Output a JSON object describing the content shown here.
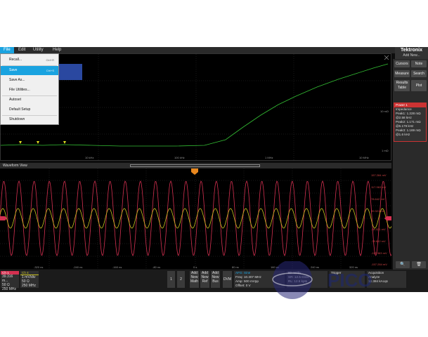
{
  "menubar": {
    "file": "File",
    "edit": "Edit",
    "utility": "Utility",
    "help": "Help"
  },
  "brand": {
    "name": "Tektronix",
    "sub": "Add New..."
  },
  "file_menu": {
    "items": [
      {
        "label": "Recall...",
        "shortcut": "Ctrl+R"
      },
      {
        "label": "Save",
        "shortcut": "Ctrl+S"
      },
      {
        "label": "Save As...",
        "shortcut": ""
      },
      {
        "label": "File Utilities...",
        "shortcut": ""
      },
      {
        "label": "Autoset",
        "shortcut": ""
      },
      {
        "label": "Default Setup",
        "shortcut": ""
      },
      {
        "label": "Shutdown",
        "shortcut": ""
      }
    ]
  },
  "spectrum": {
    "x_labels": [
      "10 kHz",
      "100 kHz",
      "1 MHz",
      "10 MHz"
    ],
    "y_labels": [
      "10 mΩ",
      "1 mΩ"
    ]
  },
  "waveform": {
    "title": "Waveform View",
    "time_labels": [
      "-320 ns",
      "-240 ns",
      "-160 ns",
      "-80 ns",
      "0 s",
      "80 ns",
      "160 ns",
      "240 ns",
      "320 ns"
    ],
    "volt_labels": [
      "157.284 mV",
      "117.963 mV",
      "78.642 mV",
      "39.321 mV",
      "-39.321 mV",
      "-78.642 mV",
      "-117.963 mV",
      "-157.284 mV"
    ]
  },
  "side": {
    "cursors": "Cursors",
    "note": "Note",
    "measure": "Measure",
    "search": "Search",
    "results": "Results Table",
    "plot": "Plot",
    "power": {
      "title": "Power 1",
      "impedance": "Impedance",
      "lines": [
        "Peak1: 1.228 mΩ",
        "@2.58 kHz",
        "Peak2: 1.171 mΩ",
        "@5.179 kHz",
        "Peak3: 1.169 mΩ",
        "@1.6 kHz"
      ]
    }
  },
  "status": {
    "ch1": {
      "head": "Ch 1",
      "l1": "39.316 m...",
      "l2": "50 Ω",
      "l3": "250 MHz"
    },
    "ch4": {
      "head": "Ch 4",
      "l1": "1 mV/div",
      "l2": "50 Ω",
      "l3": "250 MHz"
    },
    "btn1": "1",
    "btn2": "2",
    "add_math": "Add New Math",
    "add_ref": "Add New Ref",
    "add_bus": "Add New Bus",
    "dvm": "DVM",
    "afg": {
      "head": "AFG: Sine",
      "l1": "Freq: 10.307 MHz",
      "l2": "Amp: 500 mVpp",
      "l3": "Offset: 0 V"
    },
    "horizontal": {
      "l1": "80 ns/div",
      "l2": "SR: 12.5 GS/s",
      "l3": "RL: 12.5 kpts"
    },
    "trigger": {
      "head": "Trigger"
    },
    "acq": {
      "head": "Acquisition",
      "l1": "Analyze",
      "l2": "12.384 kAcqs"
    }
  },
  "colors": {
    "accent": "#1aa3e0",
    "ch1": "#d43050",
    "ch4": "#c8c020",
    "spectrum": "#34c034"
  }
}
